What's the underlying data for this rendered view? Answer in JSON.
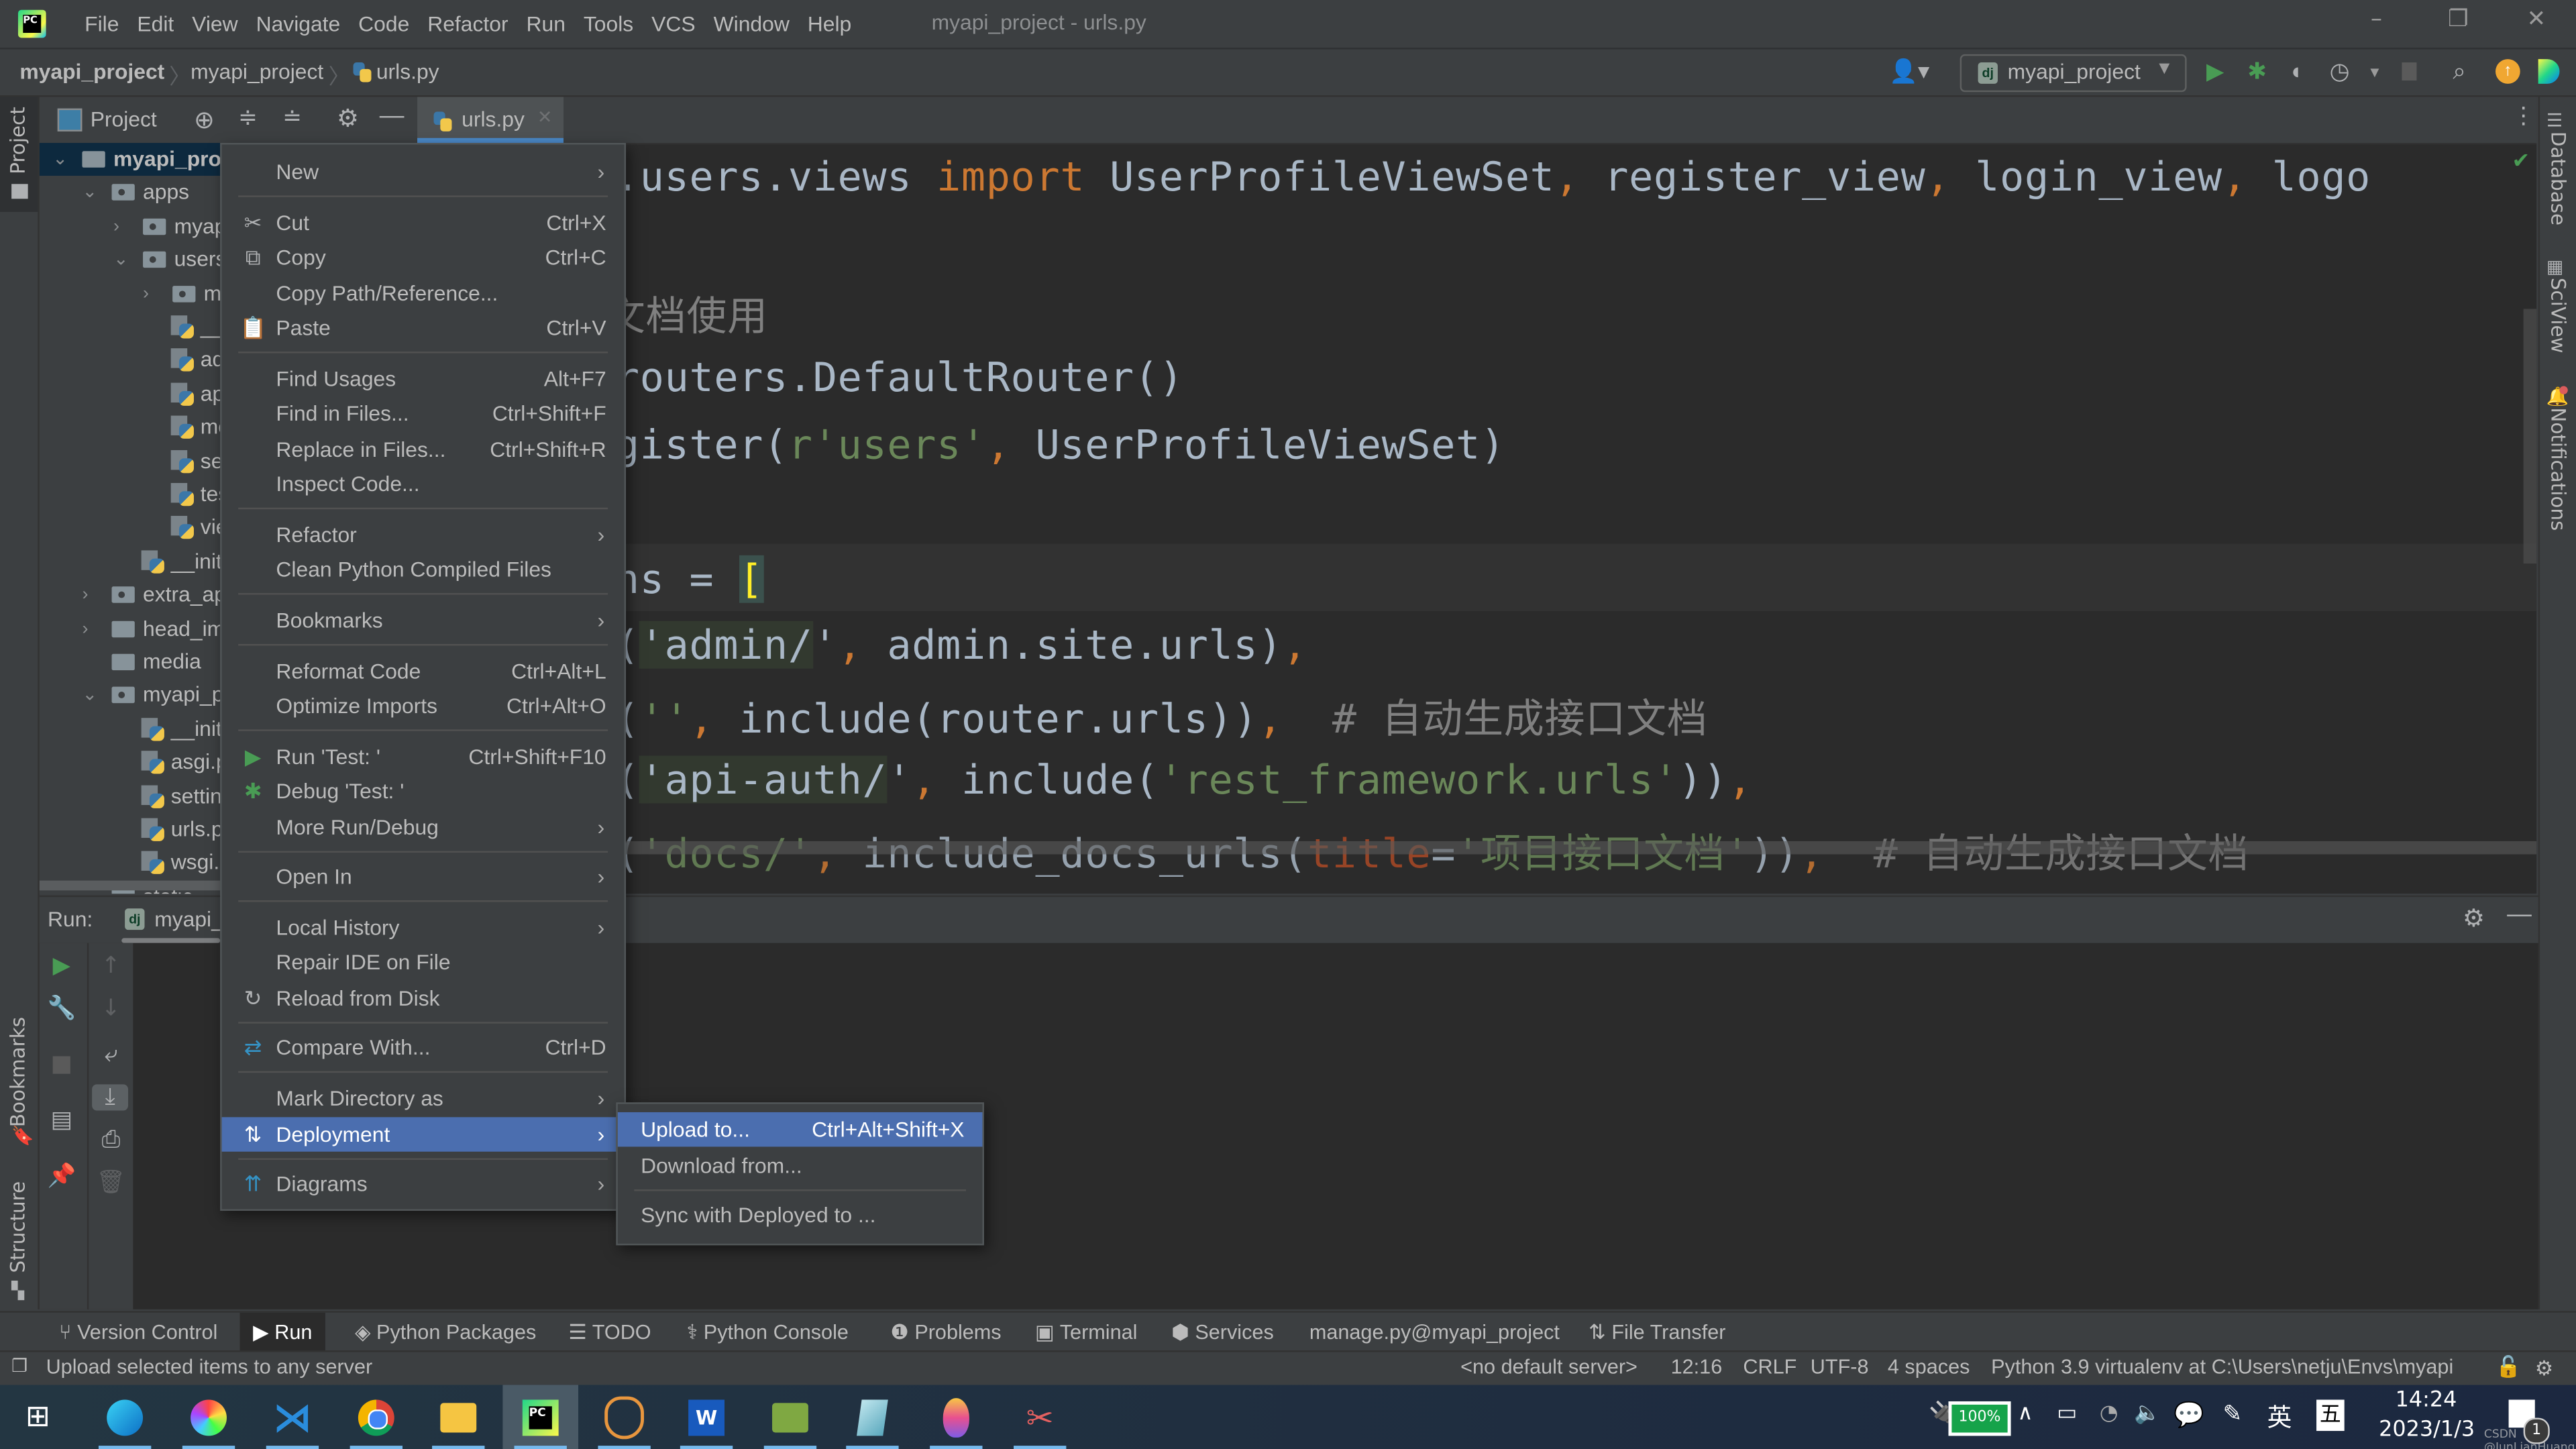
{
  "window": {
    "title": "myapi_project - urls.py",
    "menu": [
      "File",
      "Edit",
      "View",
      "Navigate",
      "Code",
      "Refactor",
      "Run",
      "Tools",
      "VCS",
      "Window",
      "Help"
    ],
    "controls": {
      "minimize": "–",
      "restore": "❐",
      "close": "✕"
    }
  },
  "navbar": {
    "breadcrumbs": [
      "myapi_project",
      "myapi_project",
      "urls.py"
    ],
    "run_config": "myapi_project",
    "icons": [
      "user-icon",
      "run-icon",
      "debug-icon",
      "coverage-icon",
      "profile-icon",
      "stop-icon",
      "search-icon",
      "update-icon",
      "toolbox-icon"
    ]
  },
  "left_stripe": {
    "project": "Project",
    "bookmarks": "Bookmarks",
    "structure": "Structure"
  },
  "right_stripe": {
    "database": "Database",
    "sciview": "SciView",
    "notifications": "Notifications"
  },
  "project_panel": {
    "title": "Project",
    "tree": [
      {
        "label": "myapi_project",
        "type": "folder",
        "depth": 0,
        "expanded": true,
        "selected": true
      },
      {
        "label": "apps",
        "type": "module",
        "depth": 1,
        "expanded": true
      },
      {
        "label": "myapi",
        "type": "module",
        "depth": 2,
        "expanded": false
      },
      {
        "label": "users",
        "type": "module",
        "depth": 2,
        "expanded": true
      },
      {
        "label": "migrations",
        "type": "module",
        "depth": 3,
        "expanded": false
      },
      {
        "label": "__init__.py",
        "type": "py",
        "depth": 4
      },
      {
        "label": "admin.py",
        "type": "py",
        "depth": 4
      },
      {
        "label": "apps.py",
        "type": "py",
        "depth": 4
      },
      {
        "label": "models.py",
        "type": "py",
        "depth": 4
      },
      {
        "label": "serializers.py",
        "type": "py",
        "depth": 4
      },
      {
        "label": "tests.py",
        "type": "py",
        "depth": 4
      },
      {
        "label": "views.py",
        "type": "py",
        "depth": 4
      },
      {
        "label": "__init__.py",
        "type": "py",
        "depth": 3
      },
      {
        "label": "extra_apps",
        "type": "module",
        "depth": 1,
        "expanded": false
      },
      {
        "label": "head_images",
        "type": "folder",
        "depth": 1,
        "expanded": false
      },
      {
        "label": "media",
        "type": "folder",
        "depth": 1
      },
      {
        "label": "myapi_project",
        "type": "module",
        "depth": 1,
        "expanded": true
      },
      {
        "label": "__init__.py",
        "type": "py",
        "depth": 3
      },
      {
        "label": "asgi.py",
        "type": "py",
        "depth": 3
      },
      {
        "label": "settings.py",
        "type": "py",
        "depth": 3
      },
      {
        "label": "urls.py",
        "type": "py",
        "depth": 3
      },
      {
        "label": "wsgi.py",
        "type": "py",
        "depth": 3
      },
      {
        "label": "static",
        "type": "folder",
        "depth": 1
      }
    ]
  },
  "editor": {
    "tab": "urls.py",
    "lines": [
      "rom apps.users.views import UserProfileViewSet, register_view, login_view, logo",
      "",
      " 生成接口文档使用",
      "outer = routers.DefaultRouter()",
      "outer.register(r'users', UserProfileViewSet)",
      "",
      "rlpatterns = [",
      "    path('admin/', admin.site.urls),",
      "    path('', include(router.urls)),  # 自动生成接口文档",
      "    path('api-auth/', include('rest_framework.urls')),",
      "    path('docs/', include_docs_urls(title='项目接口文档')),  # 自动生成接口文档"
    ],
    "comments": {
      "docs_comment": "生成接口文档使用",
      "auto_doc": "# 自动生成接口文档",
      "doc_title": "'项目接口文档'"
    }
  },
  "context_menu": {
    "items": [
      {
        "label": "New",
        "submenu": true
      },
      {
        "sep": true
      },
      {
        "label": "Cut",
        "shortcut": "Ctrl+X",
        "icon": "scissors-icon"
      },
      {
        "label": "Copy",
        "shortcut": "Ctrl+C",
        "icon": "copy-icon"
      },
      {
        "label": "Copy Path/Reference..."
      },
      {
        "label": "Paste",
        "shortcut": "Ctrl+V",
        "icon": "clipboard-icon"
      },
      {
        "sep": true
      },
      {
        "label": "Find Usages",
        "shortcut": "Alt+F7"
      },
      {
        "label": "Find in Files...",
        "shortcut": "Ctrl+Shift+F"
      },
      {
        "label": "Replace in Files...",
        "shortcut": "Ctrl+Shift+R"
      },
      {
        "label": "Inspect Code..."
      },
      {
        "sep": true
      },
      {
        "label": "Refactor",
        "submenu": true
      },
      {
        "label": "Clean Python Compiled Files"
      },
      {
        "sep": true
      },
      {
        "label": "Bookmarks",
        "submenu": true
      },
      {
        "sep": true
      },
      {
        "label": "Reformat Code",
        "shortcut": "Ctrl+Alt+L"
      },
      {
        "label": "Optimize Imports",
        "shortcut": "Ctrl+Alt+O"
      },
      {
        "sep": true
      },
      {
        "label": "Run 'Test: '",
        "shortcut": "Ctrl+Shift+F10",
        "icon": "run-icon"
      },
      {
        "label": "Debug 'Test: '",
        "icon": "debug-icon"
      },
      {
        "label": "More Run/Debug",
        "submenu": true
      },
      {
        "sep": true
      },
      {
        "label": "Open In",
        "submenu": true
      },
      {
        "sep": true
      },
      {
        "label": "Local History",
        "submenu": true
      },
      {
        "label": "Repair IDE on File"
      },
      {
        "label": "Reload from Disk",
        "icon": "reload-icon"
      },
      {
        "sep": true
      },
      {
        "label": "Compare With...",
        "shortcut": "Ctrl+D",
        "icon": "compare-icon"
      },
      {
        "sep": true
      },
      {
        "label": "Mark Directory as",
        "submenu": true
      },
      {
        "label": "Deployment",
        "submenu": true,
        "selected": true,
        "icon": "deployment-icon"
      },
      {
        "sep": true
      },
      {
        "label": "Diagrams",
        "submenu": true,
        "icon": "diagram-icon"
      }
    ]
  },
  "deployment_submenu": {
    "items": [
      {
        "label": "Upload to...",
        "shortcut": "Ctrl+Alt+Shift+X",
        "selected": true
      },
      {
        "label": "Download from..."
      },
      {
        "sep": true
      },
      {
        "label": "Sync with Deployed to ..."
      }
    ]
  },
  "run_panel": {
    "label": "Run:",
    "config": "myapi_project"
  },
  "tool_windows": [
    "Version Control",
    "Run",
    "Python Packages",
    "TODO",
    "Python Console",
    "Problems",
    "Terminal",
    "Services",
    "manage.py@myapi_project",
    "File Transfer"
  ],
  "statusbar": {
    "message": "Upload selected items to any server",
    "server": "<no default server>",
    "position": "12:16",
    "line_sep": "CRLF",
    "encoding": "UTF-8",
    "indent": "4 spaces",
    "interpreter": "Python 3.9 virtualenv at C:\\Users\\netju\\Envs\\myapi"
  },
  "taskbar": {
    "apps": [
      "start",
      "edge",
      "app-color",
      "vscode",
      "chrome",
      "explorer",
      "pycharm",
      "anaconda",
      "word",
      "file-share",
      "notepad",
      "paint",
      "snipping"
    ],
    "active_app": "pycharm",
    "battery": "100%",
    "ime": "英",
    "ime2": "五",
    "time": "14:24",
    "date": "2023/1/3",
    "notification_count": "1",
    "watermark": "CSDN @JunLianHuang"
  },
  "colors": {
    "accent": "#4b6eaf",
    "keyword": "#cc7832",
    "string": "#6a8759",
    "comment": "#808080",
    "code": "#a9b7c6",
    "run_green": "#499c54"
  }
}
